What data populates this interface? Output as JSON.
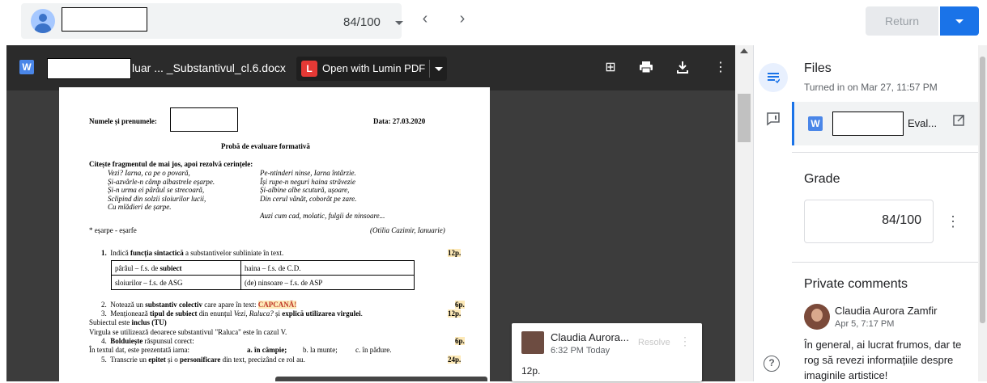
{
  "topbar": {
    "grade": "84/100",
    "return_label": "Return"
  },
  "viewer": {
    "file_title": "luar ... _Substantivul_cl.6.docx",
    "file_type_letter": "W",
    "lumin_label": "Open with Lumin PDF"
  },
  "document": {
    "name_label": "Numele și prenumele:",
    "date": "Data: 27.03.2020",
    "title": "Probă de evaluare formativă",
    "instruction": "Citește fragmentul de mai jos, apoi rezolvă cerințele:",
    "poem_left": [
      "Vezi? Iarna, ca pe o povară,",
      "Și-azvârle-n câmp albastrele eșarpe.",
      "Și-n urma ei pârâul se strecoară,",
      "Sclipind din solzii sloiurilor lucii,",
      "Cu mlădieri de șarpe."
    ],
    "poem_right": [
      "Pe-ntinderi ninse, Iarna întârzie.",
      "Își rupe-n neguri haina străvezie",
      "Și-albine albe scutură, ușoare,",
      "Din cerul vânăt, coborât pe zare.",
      "",
      "Auzi cum cad, molatic, fulgii de ninsoare..."
    ],
    "footnote": "* eșarpe - eșarfe",
    "attribution": "(Otilia Cazimir, Ianuarie)",
    "q1_num": "1.",
    "q1_pre": "Indică ",
    "q1_bold": "funcția sintactică",
    "q1_post": " a substantivelor subliniate în text.",
    "q1_points": "12p.",
    "table": [
      [
        "pârâul – f.s. de ",
        "subiect",
        "haina – f.s. de C.D."
      ],
      [
        "sloiurilor – f.s. de ASG",
        "",
        "(de) ninsoare – f.s. de ASP"
      ]
    ],
    "q2_num": "2.",
    "q2_pre": "Notează un ",
    "q2_bold": "substantiv colectiv",
    "q2_mid": " care apare în text: ",
    "q2_answer": "CAPCANĂ!",
    "q2_points": "6p.",
    "q3_num": "3.",
    "q3_pre": "Menționează ",
    "q3_bold": "tipul de subiect",
    "q3_mid": " din enunțul ",
    "q3_quote": "Vezi, Raluca?",
    "q3_and": " și ",
    "q3_bold2": "explică utilizarea virgulei",
    "q3_end": ".",
    "q3_points": "12p.",
    "a3_line1_pre": "Subiectul este ",
    "a3_line1_bold": "inclus (TU)",
    "a3_line2": "Virgula se utilizează deoarece substantivul \"Raluca\" este în cazul V.",
    "q4_num": "4.",
    "q4_bold": "Bolduiește",
    "q4_post": " răspunsul corect:",
    "q4_points": "6p.",
    "q4_line": "În textul dat, este prezentată iarna:",
    "q4_opt_a": "a. în câmpie;",
    "q4_opt_b": "b. la munte;",
    "q4_opt_c": "c. în pădure.",
    "q5_num": "5.",
    "q5_pre": "Transcrie un ",
    "q5_bold": "epitet",
    "q5_mid": " și o ",
    "q5_bold2": "personificare",
    "q5_post": " din text, precizând ce rol au.",
    "q5_points": "24p."
  },
  "inline_comment": {
    "author": "Claudia Aurora...",
    "time": "6:32 PM Today",
    "resolve": "Resolve",
    "text": "12p."
  },
  "sidebar": {
    "files_heading": "Files",
    "turned_in": "Turned in on Mar 27, 11:57 PM",
    "file_name": "Eval...",
    "file_type_letter": "W",
    "grade_heading": "Grade",
    "grade_value": "84/100",
    "private_heading": "Private comments",
    "comment_author": "Claudia Aurora Zamfir",
    "comment_time": "Apr 5, 7:17 PM",
    "comment_text": "În general, ai lucrat frumos, dar te rog să revezi informațiile despre imaginile artistice!"
  },
  "colors": {
    "accent": "#1a73e8",
    "highlight": "#fde9b7",
    "viewer_bg": "#3c3c3c"
  }
}
